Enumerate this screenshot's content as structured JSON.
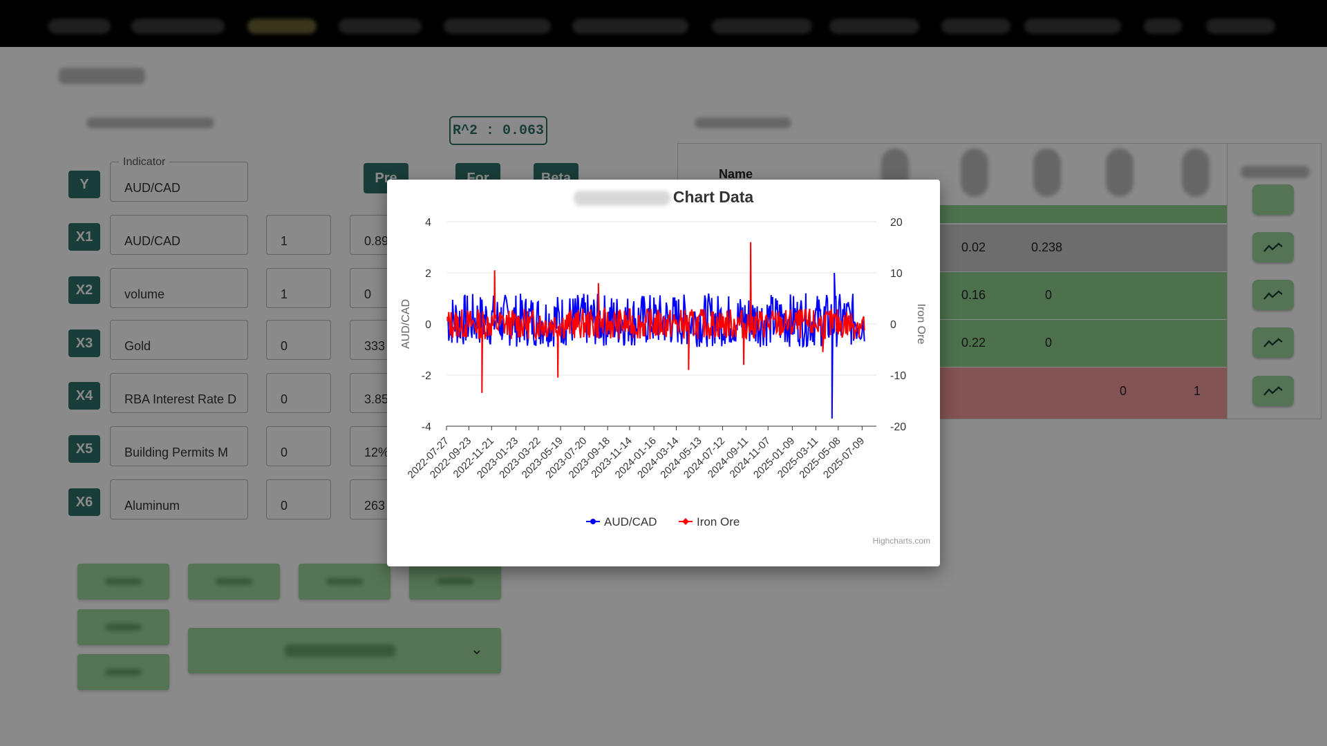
{
  "metrics": {
    "r2_label": "R^2 : 0.063"
  },
  "variables": {
    "legend_label": "Indicator",
    "rows": [
      {
        "badge": "Y",
        "value": "AUD/CAD"
      },
      {
        "badge": "X1",
        "value": "AUD/CAD",
        "num": "1",
        "num2": "0.89"
      },
      {
        "badge": "X2",
        "value": "volume",
        "num": "1",
        "num2": "0"
      },
      {
        "badge": "X3",
        "value": "Gold",
        "num": "0",
        "num2": "333"
      },
      {
        "badge": "X4",
        "value": "RBA Interest Rate D",
        "num": "0",
        "num2": "3.85"
      },
      {
        "badge": "X5",
        "value": "Building Permits M",
        "num": "0",
        "num2": "12%"
      },
      {
        "badge": "X6",
        "value": "Aluminum",
        "num": "0",
        "num2": "263"
      }
    ]
  },
  "header_buttons": [
    "Pre",
    "For",
    "Beta"
  ],
  "regression_table": {
    "name_header": "Name",
    "rows": [
      {
        "c1": "0.02",
        "c2": "0.238",
        "c3": "",
        "c4": "",
        "color": "#c9c9c9"
      },
      {
        "c1": "0.16",
        "c2": "0",
        "c3": "",
        "c4": "",
        "color": "#8fd18f"
      },
      {
        "c1": "0.22",
        "c2": "0",
        "c3": "",
        "c4": "",
        "color": "#8fd18f"
      },
      {
        "c1": "",
        "c2": "",
        "c3": "0",
        "c4": "1",
        "color": "#f49a9a"
      }
    ],
    "action_icon": "trending-chart-icon"
  },
  "chart_modal": {
    "title_visible": "Chart Data",
    "credits": "Highcharts.com"
  },
  "chart_data": {
    "type": "line",
    "title": "Chart Data",
    "x_tick_labels": [
      "2022-07-27",
      "2022-09-23",
      "2022-11-21",
      "2023-01-23",
      "2023-03-22",
      "2023-05-19",
      "2023-07-20",
      "2023-09-18",
      "2023-11-14",
      "2024-01-16",
      "2024-03-14",
      "2024-05-13",
      "2024-07-12",
      "2024-09-11",
      "2024-11-07",
      "2025-01-09",
      "2025-03-11",
      "2025-05-08",
      "2025-07-09"
    ],
    "x_range": [
      "2022-07-27",
      "2025-08-15"
    ],
    "y_left": {
      "label": "AUD/CAD",
      "range": [
        -4,
        4
      ],
      "ticks": [
        -4,
        -2,
        0,
        2,
        4
      ]
    },
    "y_right": {
      "label": "Iron Ore",
      "range": [
        -20,
        20
      ],
      "ticks": [
        -20,
        -10,
        0,
        10,
        20
      ]
    },
    "series": [
      {
        "name": "AUD/CAD",
        "color": "#0000ff",
        "axis": "left",
        "typical_range": [
          -0.9,
          1.2
        ],
        "spikes": [
          {
            "date": "2025-04-22",
            "value": -3.7
          },
          {
            "date": "2025-04-28",
            "value": 2.0
          }
        ]
      },
      {
        "name": "Iron Ore",
        "color": "#ff0000",
        "axis": "right",
        "typical_range": [
          -3,
          3
        ],
        "spikes": [
          {
            "date": "2022-10-27",
            "value": -13.5
          },
          {
            "date": "2022-11-29",
            "value": 10.5
          },
          {
            "date": "2023-05-12",
            "value": -10.5
          },
          {
            "date": "2023-08-25",
            "value": 8
          },
          {
            "date": "2024-04-15",
            "value": -9
          },
          {
            "date": "2024-09-23",
            "value": 16
          },
          {
            "date": "2024-09-05",
            "value": -8
          },
          {
            "date": "2025-03-29",
            "value": -5.5
          }
        ]
      }
    ],
    "legend": {
      "position": "bottom-center",
      "items": [
        "AUD/CAD",
        "Iron Ore"
      ]
    },
    "grid": true
  }
}
